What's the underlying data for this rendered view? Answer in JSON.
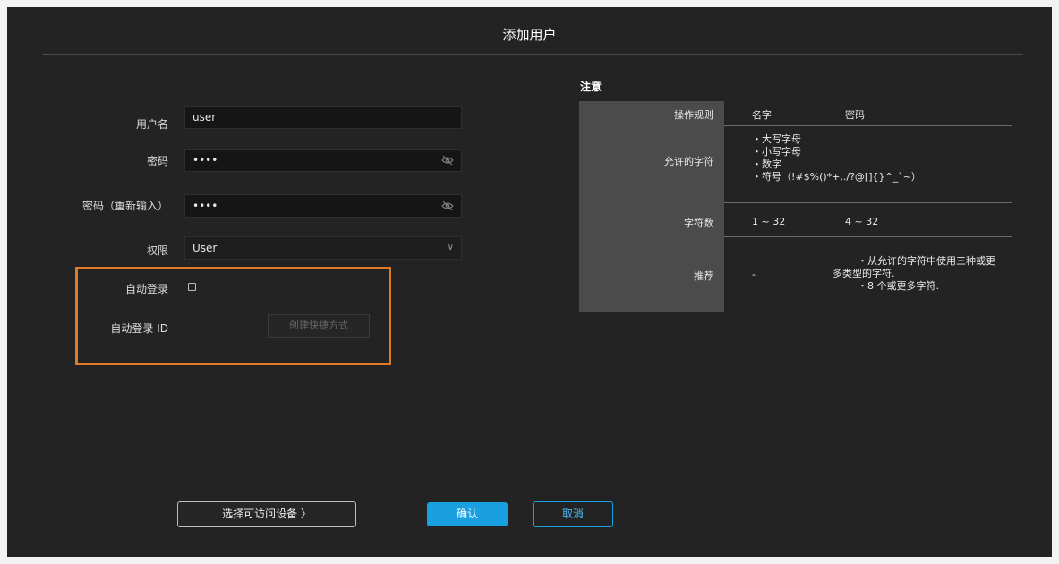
{
  "dialog": {
    "title": "添加用户"
  },
  "form": {
    "username": {
      "label": "用户名",
      "value": "user"
    },
    "password": {
      "label": "密码",
      "value": "••••"
    },
    "password_confirm": {
      "label": "密码（重新输入）",
      "value": "••••"
    },
    "permission": {
      "label": "权限",
      "value": "User"
    },
    "auto_login": {
      "label": "自动登录",
      "checked": false
    },
    "auto_login_id": {
      "label": "自动登录 ID",
      "button": "创建快捷方式"
    }
  },
  "notice": {
    "title": "注意",
    "header": {
      "rule": "操作规则",
      "name": "名字",
      "password": "密码"
    },
    "rows": {
      "allowed": {
        "label": "允许的字符",
        "lines": [
          "・大写字母",
          "・小写字母",
          "・数字",
          "・符号（!#$%()*+,./?@[]{}^_`~）"
        ]
      },
      "count": {
        "label": "字符数",
        "name": "1 ~ 32",
        "password": "4 ~ 32"
      },
      "recommend": {
        "label": "推荐",
        "name": "-",
        "password_lines": [
          "・从允许的字符中使用三种或更",
          "多类型的字符.",
          "・8 个或更多字符."
        ]
      }
    }
  },
  "footer": {
    "select_devices": "选择可访问设备 〉",
    "confirm": "确认",
    "cancel": "取消"
  },
  "colors": {
    "background": "#232323",
    "accent": "#1a9fe0",
    "highlight": "#e07b28"
  }
}
